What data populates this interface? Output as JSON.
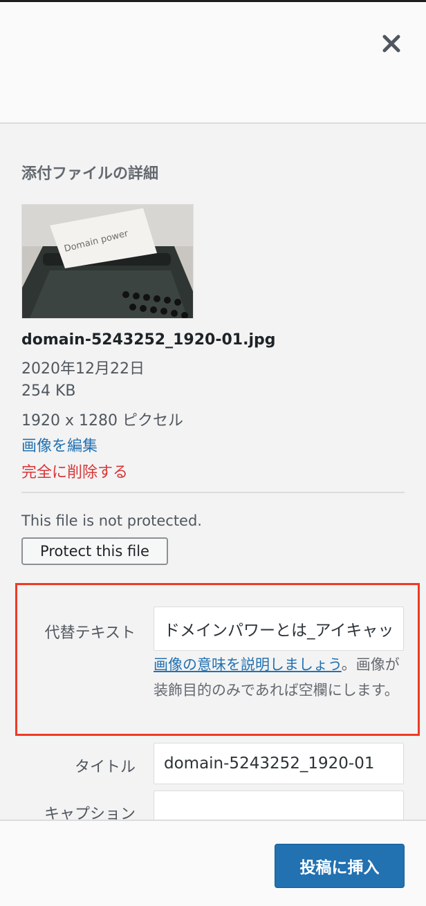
{
  "header": {
    "close_icon": "close-icon"
  },
  "details": {
    "title": "添付ファイルの詳細",
    "thumbnail_text": "Domain power",
    "filename": "domain-5243252_1920-01.jpg",
    "date": "2020年12月22日",
    "size": "254 KB",
    "dimensions": "1920 x 1280 ピクセル",
    "edit_link": "画像を編集",
    "delete_link": "完全に削除する"
  },
  "protection": {
    "status": "This file is not protected.",
    "button_label": "Protect this file"
  },
  "fields": {
    "alt_label": "代替テキスト",
    "alt_value": "ドメインパワーとは_アイキャッチ",
    "alt_help_link": "画像の意味を説明しましょう",
    "alt_help_punct": "。",
    "alt_help_text": "画像が装飾目的のみであれば空欄にします。",
    "title_label": "タイトル",
    "title_value": "domain-5243252_1920-01",
    "caption_label": "キャプション",
    "caption_value": ""
  },
  "footer": {
    "insert_button": "投稿に挿入"
  },
  "colors": {
    "highlight": "#ee3a24",
    "link": "#2271b1",
    "danger": "#d63638",
    "primary": "#2271b1"
  }
}
